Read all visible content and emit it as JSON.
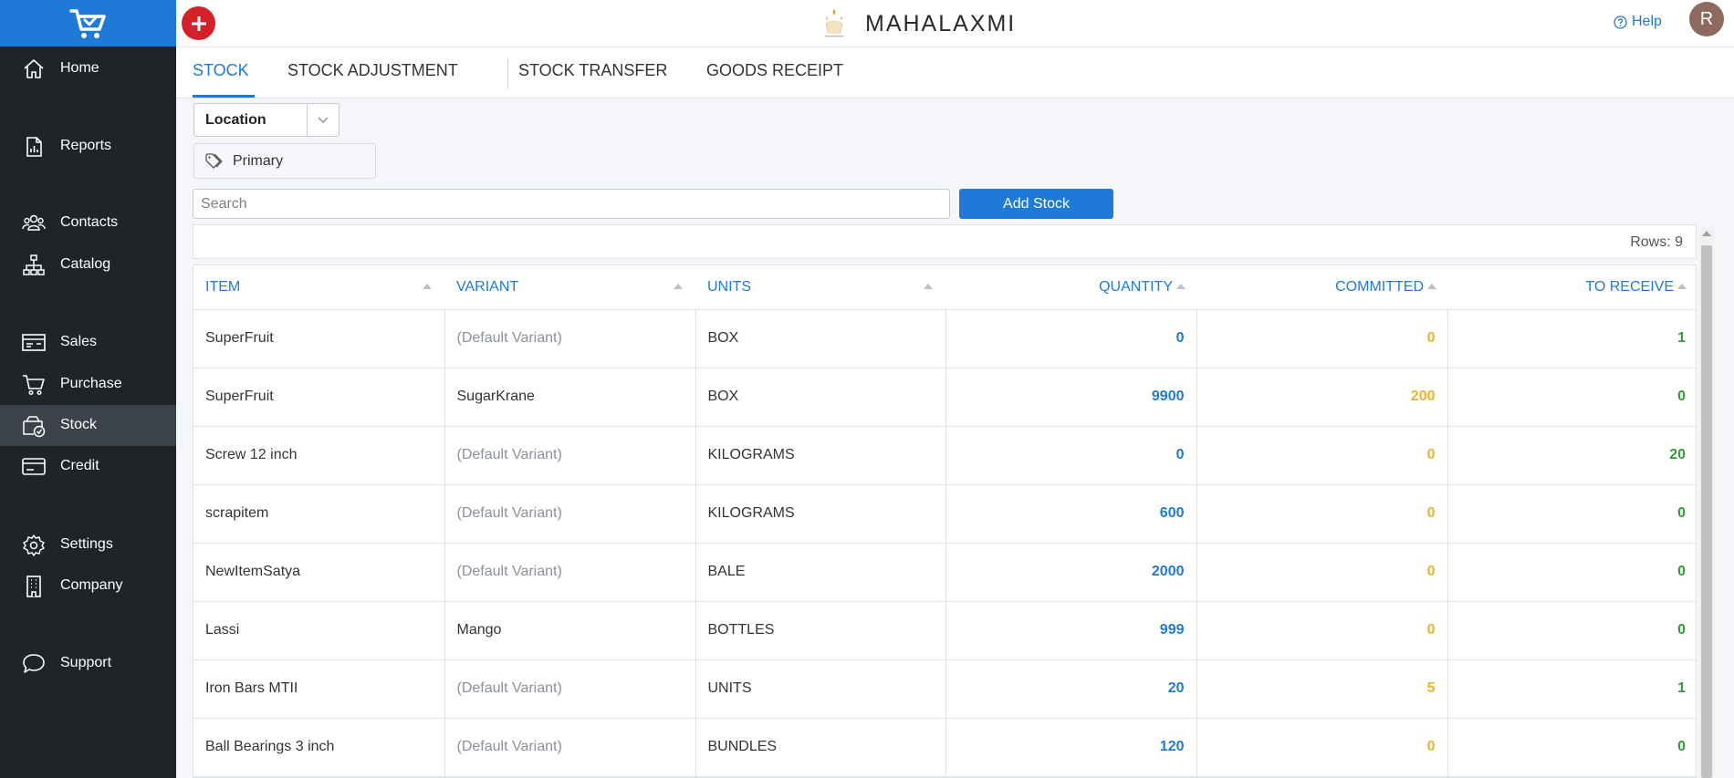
{
  "colors": {
    "accent": "#1e7ad6",
    "sidebar_bg": "#1f2429",
    "quantity": "#1e7ad6",
    "committed": "#f2b02c",
    "to_receive": "#2e9d3a",
    "add_button": "#d32129"
  },
  "sidebar": {
    "logo_icon": "shopping-cart-check-icon",
    "items": [
      {
        "label": "Home",
        "icon": "home-icon"
      },
      {
        "label": "Reports",
        "icon": "report-icon"
      },
      {
        "label": "Contacts",
        "icon": "contacts-icon"
      },
      {
        "label": "Catalog",
        "icon": "catalog-icon"
      },
      {
        "label": "Sales",
        "icon": "sales-icon"
      },
      {
        "label": "Purchase",
        "icon": "cart-icon"
      },
      {
        "label": "Stock",
        "icon": "stock-icon",
        "active": true
      },
      {
        "label": "Credit",
        "icon": "credit-card-icon"
      },
      {
        "label": "Settings",
        "icon": "gear-icon"
      },
      {
        "label": "Company",
        "icon": "building-icon"
      },
      {
        "label": "Support",
        "icon": "chat-icon"
      }
    ]
  },
  "header": {
    "brand_name": "MAHALAXMI",
    "help_label": "Help",
    "avatar_initial": "R"
  },
  "tabs": [
    {
      "label": "STOCK",
      "active": true
    },
    {
      "label": "STOCK ADJUSTMENT"
    },
    {
      "label": "STOCK TRANSFER"
    },
    {
      "label": "GOODS RECEIPT"
    }
  ],
  "filters": {
    "location_label": "Location",
    "tag_label": "Primary",
    "search_placeholder": "Search",
    "add_stock_label": "Add Stock"
  },
  "table": {
    "rows_text": "Rows: 9",
    "columns": [
      "ITEM",
      "VARIANT",
      "UNITS",
      "QUANTITY",
      "COMMITTED",
      "TO RECEIVE"
    ],
    "rows": [
      {
        "item": "SuperFruit",
        "variant": "(Default Variant)",
        "units": "BOX",
        "quantity": "0",
        "committed": "0",
        "to_receive": "1"
      },
      {
        "item": "SuperFruit",
        "variant": "SugarKrane",
        "units": "BOX",
        "quantity": "9900",
        "committed": "200",
        "to_receive": "0"
      },
      {
        "item": "Screw 12 inch",
        "variant": "(Default Variant)",
        "units": "KILOGRAMS",
        "quantity": "0",
        "committed": "0",
        "to_receive": "20"
      },
      {
        "item": "scrapitem",
        "variant": "(Default Variant)",
        "units": "KILOGRAMS",
        "quantity": "600",
        "committed": "0",
        "to_receive": "0"
      },
      {
        "item": "NewItemSatya",
        "variant": "(Default Variant)",
        "units": "BALE",
        "quantity": "2000",
        "committed": "0",
        "to_receive": "0"
      },
      {
        "item": "Lassi",
        "variant": "Mango",
        "units": "BOTTLES",
        "quantity": "999",
        "committed": "0",
        "to_receive": "0"
      },
      {
        "item": "Iron Bars MTII",
        "variant": "(Default Variant)",
        "units": "UNITS",
        "quantity": "20",
        "committed": "5",
        "to_receive": "1"
      },
      {
        "item": "Ball Bearings 3 inch",
        "variant": "(Default Variant)",
        "units": "BUNDLES",
        "quantity": "120",
        "committed": "0",
        "to_receive": "0"
      }
    ]
  }
}
